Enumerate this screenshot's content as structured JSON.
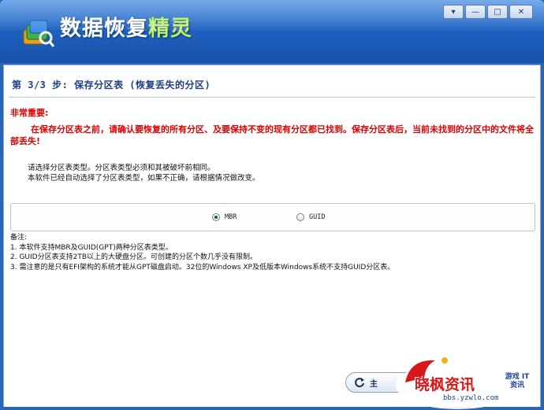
{
  "app": {
    "title_main": "数据恢复",
    "title_highlight": "精灵"
  },
  "window_controls": {
    "menu": "▾",
    "minimize": "—",
    "maximize": "□",
    "close": "✕"
  },
  "step": {
    "title": "第 3/3 步: 保存分区表 (恢复丢失的分区)"
  },
  "important": {
    "title": "非常重要:",
    "text": "在保存分区表之前，请确认要恢复的所有分区、及要保持不变的现有分区都已找到。保存分区表后，当前未找到的分区中的文件将全部丢失!"
  },
  "description": {
    "line1": "请选择分区表类型。分区表类型必须和其被破坏前相同。",
    "line2": "本软件已经自动选择了分区表类型，如果不正确，请根据情况做改变。"
  },
  "partition_type": {
    "options": [
      {
        "label": "MBR",
        "selected": true
      },
      {
        "label": "GUID",
        "selected": false
      }
    ]
  },
  "notes": {
    "title": "备注:",
    "items": [
      "1. 本软件支持MBR及GUID(GPT)两种分区表类型。",
      "2. GUID分区表支持2TB以上的大硬盘分区。可创建的分区个数几乎没有限制。",
      "3. 需注意的是只有EFI架构的系统才能从GPT磁盘启动。32位的Windows XP及低版本Windows系统不支持GUID分区表。"
    ]
  },
  "main_button": {
    "label": "主"
  },
  "watermark": {
    "brand": "晓枫资讯",
    "url": "bbs.yzwlo.com",
    "side": "游戏 IT 资讯"
  },
  "colors": {
    "accent_blue": "#1f62bf",
    "warning_red": "#e00000",
    "title_green": "#b6f25a"
  }
}
